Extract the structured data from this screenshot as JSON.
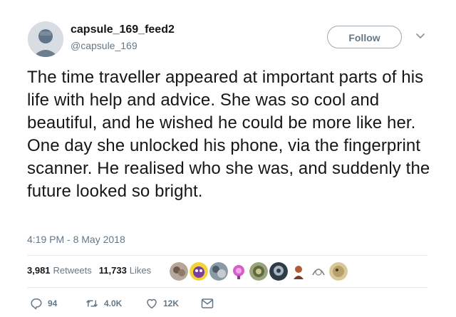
{
  "user": {
    "display_name": "capsule_169_feed2",
    "handle": "@capsule_169"
  },
  "header": {
    "follow_label": "Follow",
    "caret_icon": "chevron-down-icon"
  },
  "tweet": {
    "text": "The time traveller appeared at important parts of his life with help and advice. She was so cool and beautiful, and he wished he could be more like her. One day she unlocked his phone, via the fingerprint scanner. He realised who she was, and suddenly the future looked so bright.",
    "timestamp": "4:19 PM - 8 May 2018"
  },
  "stats": {
    "retweets_count": "3,981",
    "retweets_label": "Retweets",
    "likes_count": "11,733",
    "likes_label": "Likes"
  },
  "likers": [
    "liker-avatar",
    "liker-avatar",
    "liker-avatar",
    "liker-avatar",
    "liker-avatar",
    "liker-avatar",
    "liker-avatar",
    "liker-avatar",
    "liker-avatar",
    "liker-avatar"
  ],
  "actions": {
    "reply_count": "94",
    "retweet_count": "4.0K",
    "like_count": "12K"
  },
  "colors": {
    "text_primary": "#14171a",
    "text_secondary": "#657786",
    "divider": "#e6ecf0",
    "follow_border": "#9eaab5"
  }
}
